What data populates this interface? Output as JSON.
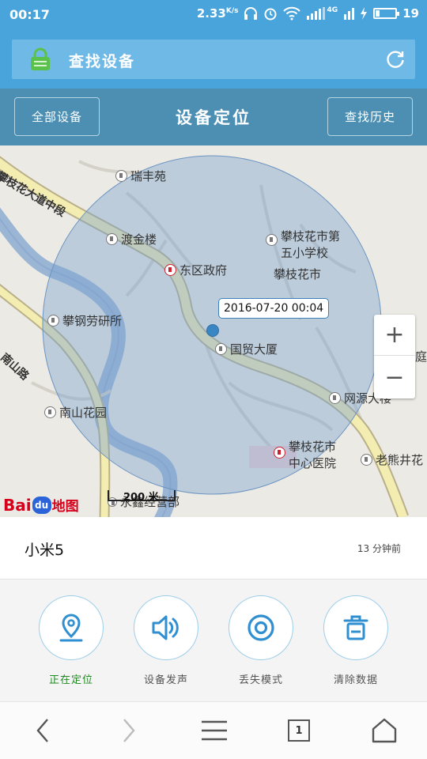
{
  "status_bar": {
    "time": "00:17",
    "network_speed": "2.33",
    "network_unit": "K/s",
    "signal_label": "4G",
    "battery_level": "19"
  },
  "app_bar": {
    "title": "查找设备",
    "lock_icon": "lock-icon",
    "refresh_icon": "refresh-icon"
  },
  "section_header": {
    "left_button": "全部设备",
    "title": "设备定位",
    "right_button": "查找历史"
  },
  "map": {
    "timestamp_tooltip": "2016-07-20 00:04",
    "road_labels": [
      "攀枝花大道中段",
      "南山路"
    ],
    "pois": [
      {
        "label": "瑞丰苑"
      },
      {
        "label": "渡金楼"
      },
      {
        "label": "东区政府"
      },
      {
        "label": "攀枝花市第"
      },
      {
        "label": "五小学校"
      },
      {
        "label": "攀枝花市"
      },
      {
        "label": "攀钢劳研所"
      },
      {
        "label": "国贸大厦"
      },
      {
        "label": "南山花园"
      },
      {
        "label": "网源大楼"
      },
      {
        "label": "攀枝花市"
      },
      {
        "label": "中心医院"
      },
      {
        "label": "老熊井花"
      },
      {
        "label": "华庭"
      },
      {
        "label": "永鑫经营部"
      }
    ],
    "zoom_in": "+",
    "zoom_out": "−",
    "scale_label": "200 米",
    "logo_text_left": "Bai",
    "logo_text_paw": "du",
    "logo_text_right": "地图"
  },
  "device": {
    "name": "小米5",
    "last_seen": "13 分钟前"
  },
  "actions": [
    {
      "label": "正在定位",
      "icon": "location-pin-icon",
      "active": true
    },
    {
      "label": "设备发声",
      "icon": "speaker-icon",
      "active": false
    },
    {
      "label": "丢失模式",
      "icon": "target-icon",
      "active": false
    },
    {
      "label": "清除数据",
      "icon": "trash-icon",
      "active": false
    }
  ],
  "bottom_nav": {
    "back_icon": "back-arrow-icon",
    "forward_icon": "forward-arrow-icon",
    "menu_icon": "menu-icon",
    "tab_count": "1",
    "home_icon": "home-icon"
  },
  "colors": {
    "header_blue": "#4aa4dc",
    "section_blue": "#4d8fb3",
    "accent_icon": "#2f8fd1",
    "active_green": "#1f8a20"
  }
}
